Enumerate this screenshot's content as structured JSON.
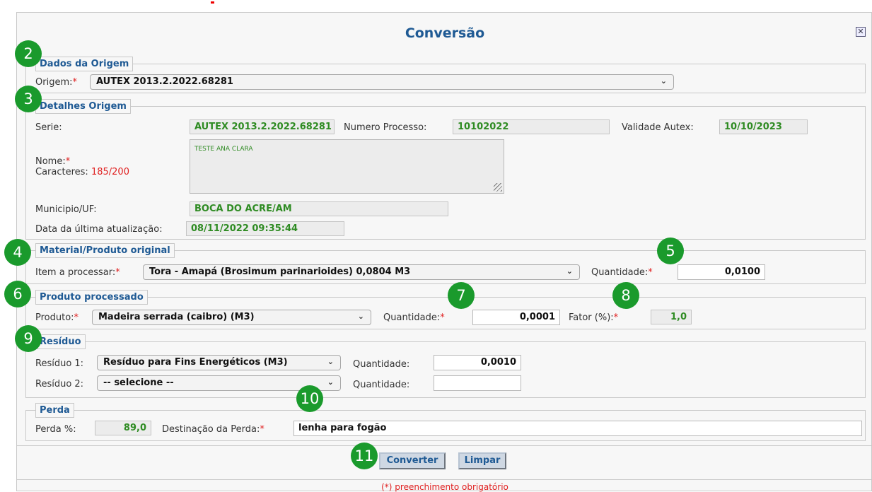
{
  "dialog": {
    "title": "Conversão"
  },
  "badges": [
    "2",
    "3",
    "4",
    "5",
    "6",
    "7",
    "8",
    "9",
    "10",
    "11"
  ],
  "origem": {
    "legend": "Dados da Origem",
    "label": "Origem:",
    "req": "*",
    "value": "AUTEX 2013.2.2022.68281"
  },
  "detalhes": {
    "legend": "Detalhes Origem",
    "serie_label": "Serie:",
    "serie_value": "AUTEX 2013.2.2022.68281",
    "numero_label": "Numero Processo:",
    "numero_value": "10102022",
    "validade_label": "Validade Autex:",
    "validade_value": "10/10/2023",
    "nome_label": "Nome:",
    "nome_req": "*",
    "caracteres_label": "Caracteres:",
    "caracteres_value": "185/200",
    "nome_value": "TESTE ANA CLARA",
    "municipio_label": "Municipio/UF:",
    "municipio_value": "BOCA DO ACRE/AM",
    "atualizacao_label": "Data da última atualização:",
    "atualizacao_value": "08/11/2022 09:35:44"
  },
  "material": {
    "legend": "Material/Produto original",
    "item_label": "Item a processar:",
    "req": "*",
    "item_value": "Tora - Amapá (Brosimum parinarioides) 0,0804 M3",
    "quantidade_label": "Quantidade:",
    "quantidade_value": "0,0100"
  },
  "produto": {
    "legend": "Produto processado",
    "produto_label": "Produto:",
    "req": "*",
    "produto_value": "Madeira serrada (caibro) (M3)",
    "quantidade_label": "Quantidade:",
    "quantidade_value": "0,0001",
    "fator_label": "Fator (%):",
    "fator_value": "1,0"
  },
  "residuo": {
    "legend": "Resíduo",
    "residuo1_label": "Resíduo 1:",
    "residuo1_value": "Resíduo para Fins Energéticos (M3)",
    "quantidade1_label": "Quantidade:",
    "quantidade1_value": "0,0010",
    "residuo2_label": "Resíduo 2:",
    "residuo2_value": "-- selecione --",
    "quantidade2_label": "Quantidade:",
    "quantidade2_value": ""
  },
  "perda": {
    "legend": "Perda",
    "perda_label": "Perda %:",
    "perda_value": "89,0",
    "destinacao_label": "Destinação da Perda:",
    "req": "*",
    "destinacao_value": "lenha para fogão"
  },
  "actions": {
    "converter": "Converter",
    "limpar": "Limpar"
  },
  "footer": {
    "note": "(*) preenchimento obrigatório"
  },
  "icons": {
    "close": "close-icon",
    "chevron": "chevron-down-icon",
    "resize": "resize-grip-icon"
  }
}
